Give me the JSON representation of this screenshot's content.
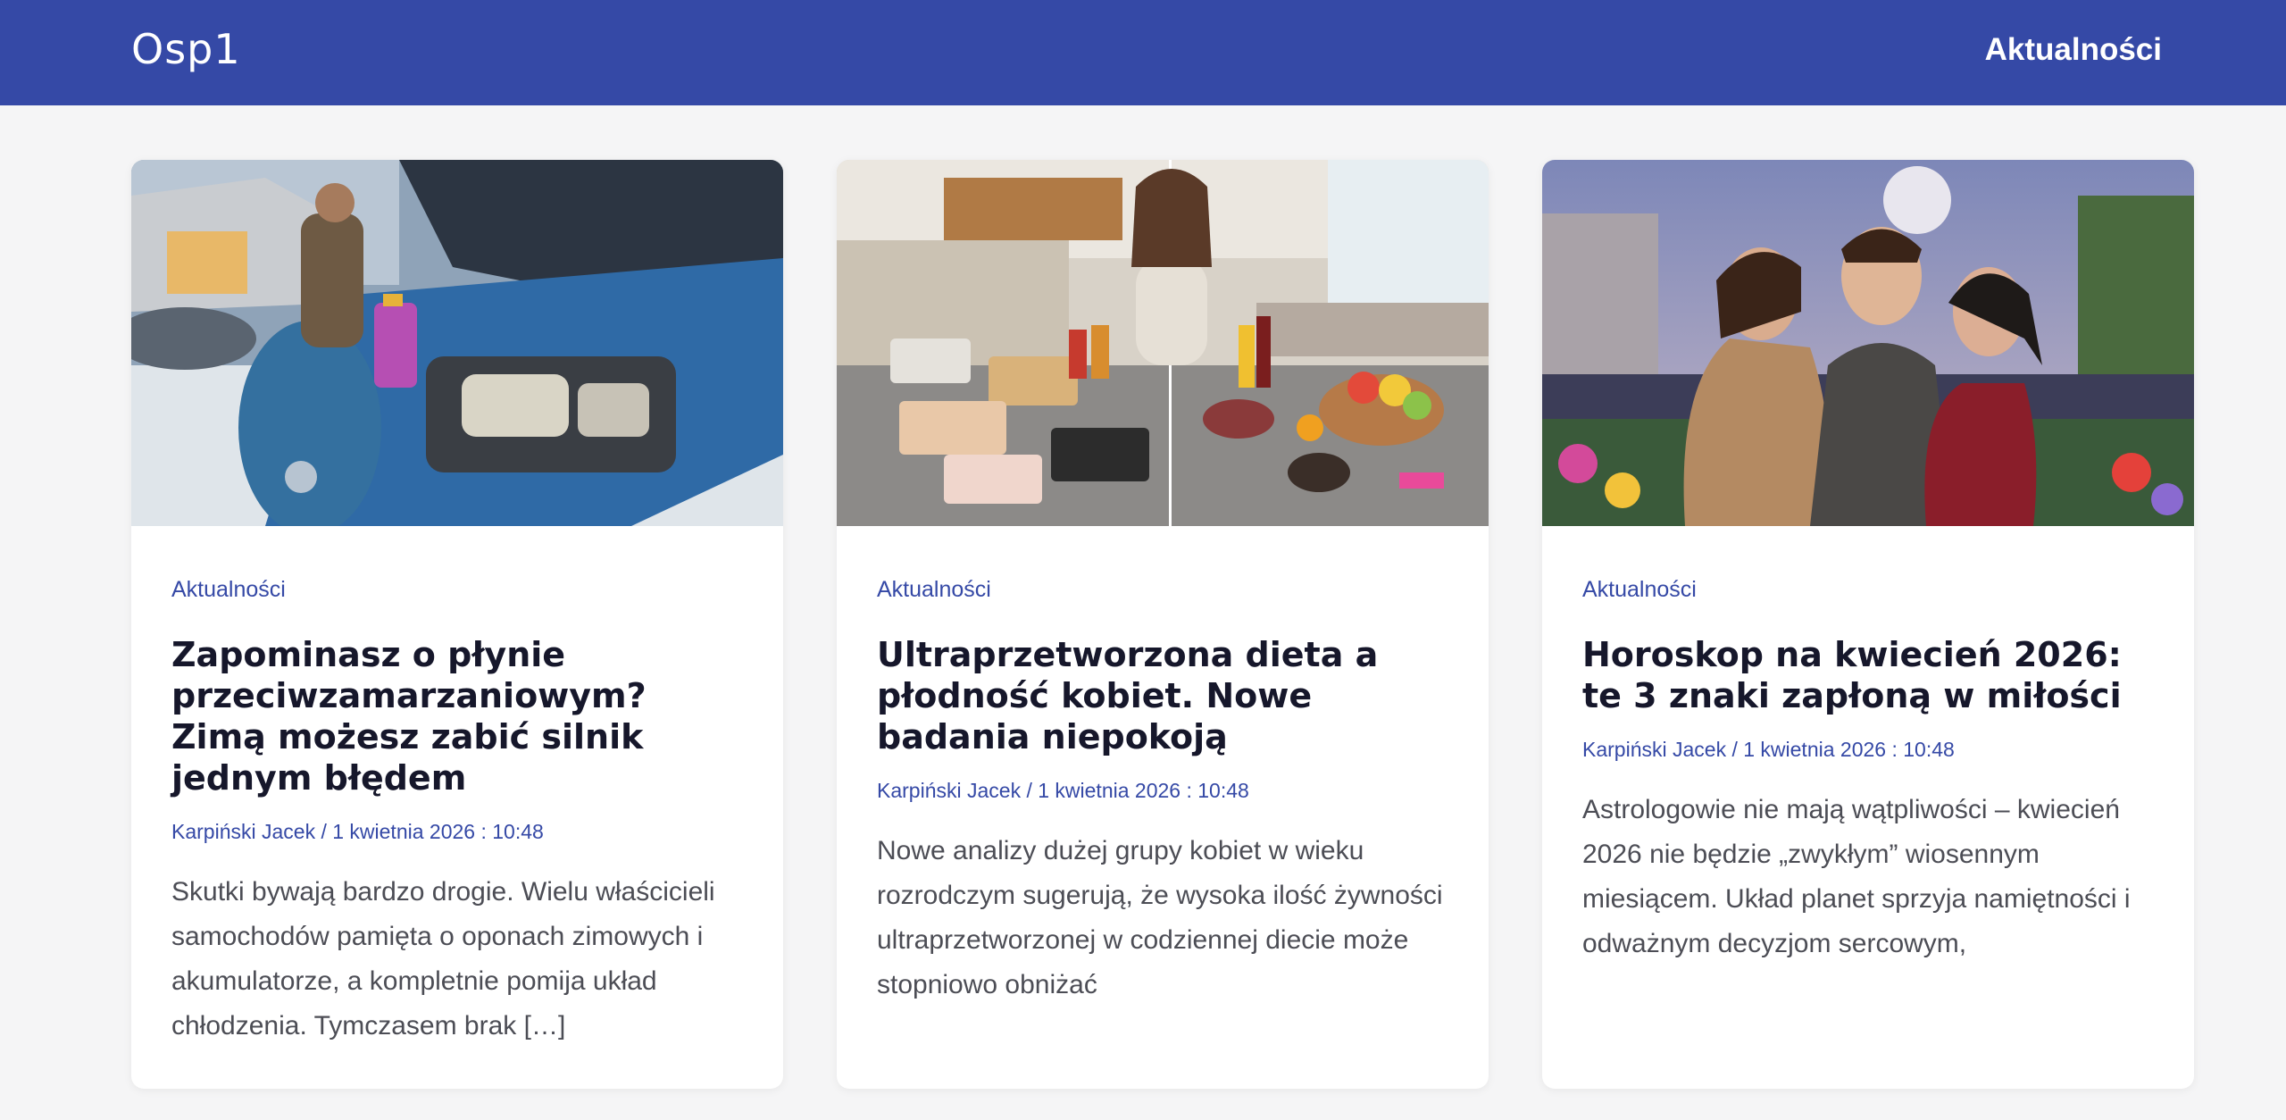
{
  "header": {
    "logo": "Osp1",
    "nav": {
      "label": "Aktualności"
    }
  },
  "colors": {
    "accent": "#3549a6",
    "title": "#16172b",
    "text": "#4c4d55",
    "background": "#f5f5f6"
  },
  "articles": [
    {
      "image_icon": "car-engine-photo",
      "category": "Aktualności",
      "title": "Zapominasz o płynie przeciwzamarzaniowym? Zimą możesz zabić silnik jednym błędem",
      "meta": "Karpiński Jacek / 1 kwietnia 2026 : 10:48",
      "excerpt": "Skutki bywają bardzo drogie. Wielu właścicieli samochodów pamięta o oponach zimowych i akumulatorze, a kompletnie pomija układ chłodzenia. Tymczasem brak […]"
    },
    {
      "image_icon": "processed-food-photo",
      "category": "Aktualności",
      "title": "Ultraprzetworzona dieta a płodność kobiet. Nowe badania niepokoją",
      "meta": "Karpiński Jacek / 1 kwietnia 2026 : 10:48",
      "excerpt": "Nowe analizy dużej grupy kobiet w wieku rozrodczym sugerują, że wysoka ilość żywności ultraprzetworzonej w codziennej diecie może stopniowo obniżać"
    },
    {
      "image_icon": "romantic-couple-photo",
      "category": "Aktualności",
      "title": "Horoskop na kwiecień 2026: te 3 znaki zapłoną w miłości",
      "meta": "Karpiński Jacek / 1 kwietnia 2026 : 10:48",
      "excerpt": "Astrologowie nie mają wątpliwości – kwiecień 2026 nie będzie „zwykłym” wiosennym miesiącem. Układ planet sprzyja namiętności i odważnym decyzjom sercowym,"
    }
  ]
}
